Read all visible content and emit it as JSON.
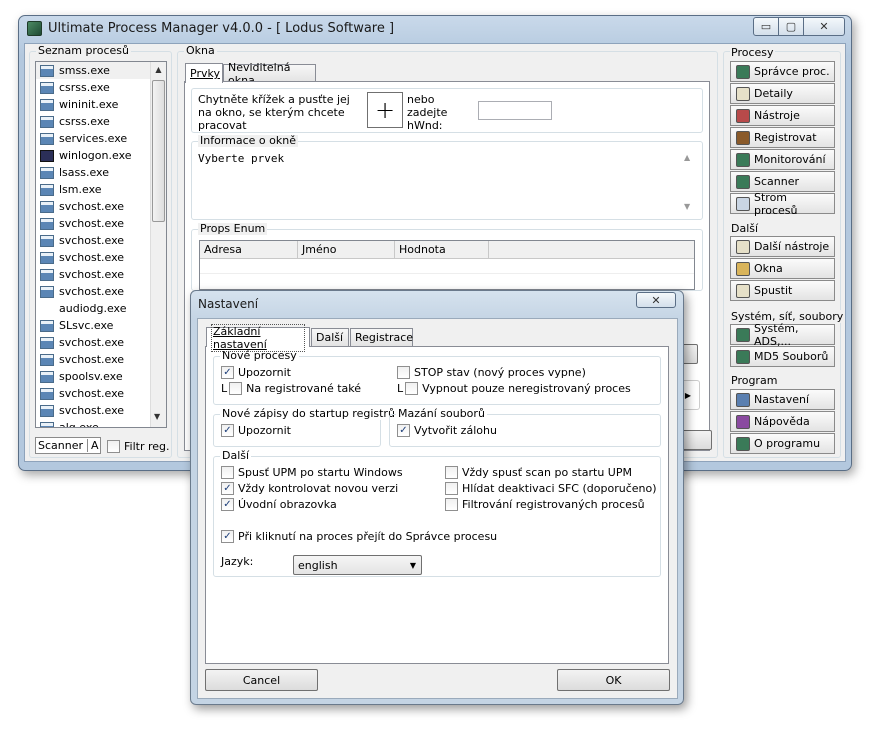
{
  "window": {
    "title": "Ultimate Process Manager v4.0.0 - [ Lodus Software ]",
    "min": "▭",
    "max": "▢",
    "close": "✕"
  },
  "left": {
    "group_label": "Seznam procesů",
    "processes": [
      {
        "name": "smss.exe",
        "icon": "process-icon"
      },
      {
        "name": "csrss.exe",
        "icon": "process-icon"
      },
      {
        "name": "wininit.exe",
        "icon": "process-icon"
      },
      {
        "name": "csrss.exe",
        "icon": "process-icon"
      },
      {
        "name": "services.exe",
        "icon": "process-icon"
      },
      {
        "name": "winlogon.exe",
        "icon": "winlogon-icon"
      },
      {
        "name": "lsass.exe",
        "icon": "process-icon"
      },
      {
        "name": "lsm.exe",
        "icon": "process-icon"
      },
      {
        "name": "svchost.exe",
        "icon": "process-icon"
      },
      {
        "name": "svchost.exe",
        "icon": "process-icon"
      },
      {
        "name": "svchost.exe",
        "icon": "process-icon"
      },
      {
        "name": "svchost.exe",
        "icon": "process-icon"
      },
      {
        "name": "svchost.exe",
        "icon": "process-icon"
      },
      {
        "name": "svchost.exe",
        "icon": "process-icon"
      },
      {
        "name": "audiodg.exe",
        "icon": "none"
      },
      {
        "name": "SLsvc.exe",
        "icon": "process-icon"
      },
      {
        "name": "svchost.exe",
        "icon": "process-icon"
      },
      {
        "name": "svchost.exe",
        "icon": "process-icon"
      },
      {
        "name": "spoolsv.exe",
        "icon": "process-icon"
      },
      {
        "name": "svchost.exe",
        "icon": "process-icon"
      },
      {
        "name": "svchost.exe",
        "icon": "process-icon"
      },
      {
        "name": "alg.exe",
        "icon": "process-icon"
      }
    ],
    "scanner_label": "Scanner",
    "scanner_key": "A",
    "filter_label": "Filtr reg."
  },
  "okna": {
    "group_label": "Okna",
    "tabs": [
      "Prvky",
      "Neviditelná okna"
    ],
    "drag_text": "Chytněte křížek a pusťte jej na okno, se kterým chcete pracovat",
    "crosshair": "+",
    "hwnd_text": "nebo zadejte hWnd:",
    "hwnd_value": "",
    "info_label": "Informace o okně",
    "info_text": "Vyberte prvek",
    "props_label": "Props Enum",
    "columns": [
      "Adresa",
      "Jméno",
      "Hodnota"
    ]
  },
  "right": {
    "procesy_label": "Procesy",
    "procesy": [
      {
        "label": "Správce proc.",
        "icon": "process-manager-icon",
        "color": "#3a7a58"
      },
      {
        "label": "Detaily",
        "icon": "details-icon",
        "color": "#e6e0c8"
      },
      {
        "label": "Nástroje",
        "icon": "tools-icon",
        "color": "#b84a4a"
      },
      {
        "label": "Registrovat",
        "icon": "register-icon",
        "color": "#8a5a2a"
      },
      {
        "label": "Monitorování",
        "icon": "monitor-icon",
        "color": "#3a7a58"
      },
      {
        "label": "Scanner",
        "icon": "scanner-icon",
        "color": "#3a7a58"
      },
      {
        "label": "Strom procesů",
        "icon": "tree-icon",
        "color": "#c9d5e3"
      }
    ],
    "dalsi_label": "Další",
    "dalsi": [
      {
        "label": "Další nástroje",
        "icon": "more-tools-icon",
        "color": "#e6e0c8"
      },
      {
        "label": "Okna",
        "icon": "windows-icon",
        "color": "#d9b45a"
      },
      {
        "label": "Spustit",
        "icon": "run-icon",
        "color": "#e6e0c8"
      }
    ],
    "system_label": "Systém, síť, soubory",
    "system": [
      {
        "label": "Systém, ADS,...",
        "icon": "system-icon",
        "color": "#3a7a58"
      },
      {
        "label": "MD5 Souborů",
        "icon": "md5-icon",
        "color": "#3a7a58"
      }
    ],
    "program_label": "Program",
    "program": [
      {
        "label": "Nastavení",
        "icon": "settings-icon",
        "color": "#5a7fb0"
      },
      {
        "label": "Nápověda",
        "icon": "help-icon",
        "color": "#8a4aa0"
      },
      {
        "label": "O programu",
        "icon": "about-icon",
        "color": "#3a7a58"
      }
    ]
  },
  "dialog": {
    "title": "Nastavení",
    "close": "✕",
    "tabs": [
      "Základní nastavení",
      "Další",
      "Registrace"
    ],
    "nove_procesy": {
      "label": "Nové procesy",
      "upozornit": "Upozornit",
      "registered": "Na registrované také",
      "stop": "STOP stav (nový proces vypne)",
      "vypnout": "Vypnout pouze neregistrovaný proces",
      "prefix": "L"
    },
    "startup": {
      "label": "Nové zápisy do startup registrů",
      "upozornit": "Upozornit"
    },
    "mazani": {
      "label": "Mazání souborů",
      "zaloha": "Vytvořit zálohu"
    },
    "dalsi": {
      "label": "Další",
      "left": [
        {
          "text": "Spusť UPM po startu Windows",
          "checked": false
        },
        {
          "text": "Vždy kontrolovat novou verzi",
          "checked": true
        },
        {
          "text": "Úvodní obrazovka",
          "checked": true
        }
      ],
      "right": [
        {
          "text": "Vždy spusť scan po startu UPM",
          "checked": false
        },
        {
          "text": "Hlídat deaktivaci SFC (doporučeno)",
          "checked": false
        },
        {
          "text": "Filtrování registrovaných procesů",
          "checked": false
        }
      ],
      "click": "Při kliknutí na proces přejít do Správce procesu",
      "jazyk_label": "Jazyk:",
      "jazyk_value": "english"
    },
    "cancel": "Cancel",
    "ok": "OK"
  }
}
